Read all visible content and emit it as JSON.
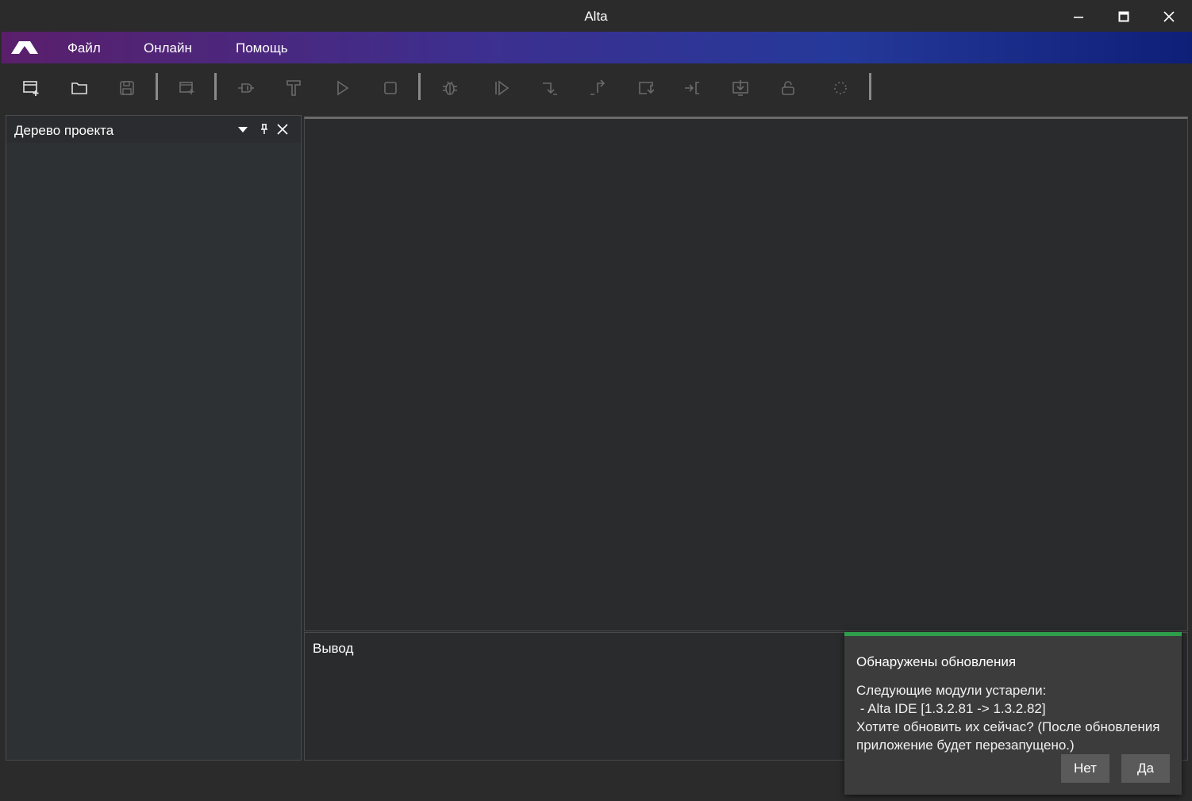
{
  "window": {
    "title": "Alta"
  },
  "menu": {
    "items": [
      "Файл",
      "Онлайн",
      "Помощь"
    ]
  },
  "toolbar": {
    "icons": [
      "new-project-icon",
      "open-folder-icon",
      "save-icon",
      "add-window-icon",
      "connect-plug-icon",
      "build-hammer-icon",
      "run-play-icon",
      "stop-icon",
      "debug-bug-icon",
      "continue-icon",
      "step-over-icon",
      "step-into-icon",
      "step-out-icon",
      "run-to-cursor-icon",
      "download-icon",
      "unlock-icon",
      "loading-icon"
    ]
  },
  "project_tree": {
    "title": "Дерево проекта"
  },
  "output": {
    "title": "Вывод"
  },
  "update_toast": {
    "title": "Обнаружены обновления",
    "lines": [
      "Следующие модули устарели:",
      " - Alta IDE [1.3.2.81 -> 1.3.2.82]",
      "Хотите обновить их сейчас? (После обновления",
      "приложение будет перезапущено.)"
    ],
    "no_label": "Нет",
    "yes_label": "Да",
    "accent": "#2e9e4a"
  }
}
